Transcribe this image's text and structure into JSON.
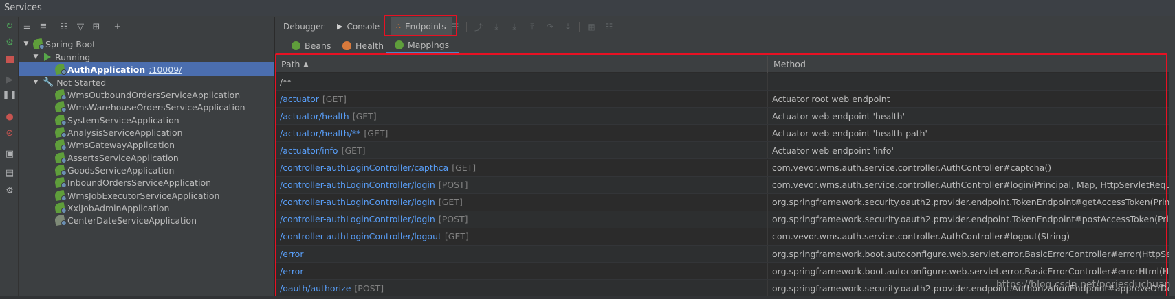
{
  "window": {
    "title": "Services"
  },
  "colors": {
    "highlight": "#e81123",
    "link": "#589df6",
    "selection": "#4b6eaf"
  },
  "left_toolbar": {
    "icons": [
      "refresh-icon",
      "deploy-icon",
      "stop-icon",
      "resume-icon",
      "pause-icon",
      "breakpoints-icon",
      "mute-breakpoints-icon",
      "camera-icon",
      "layout-icon",
      "settings-icon"
    ]
  },
  "tree_toolbar": {
    "icons": [
      "expand-all-icon",
      "collapse-all-icon",
      "group-icon",
      "filter-icon",
      "new-window-icon",
      "add-icon"
    ]
  },
  "tree": {
    "root": "Spring Boot",
    "running_label": "Running",
    "running": [
      {
        "name": "AuthApplication",
        "port": ":10009/"
      }
    ],
    "not_started_label": "Not Started",
    "not_started": [
      "WmsOutboundOrdersServiceApplication",
      "WmsWarehouseOrdersServiceApplication",
      "SystemServiceApplication",
      "AnalysisServiceApplication",
      "WmsGatewayApplication",
      "AssertsServiceApplication",
      "GoodsServiceApplication",
      "InboundOrdersServiceApplication",
      "WmsJobExecutorServiceApplication",
      "XxlJobAdminApplication",
      "CenterDateServiceApplication"
    ]
  },
  "tabs": [
    "Debugger",
    "Console",
    "Endpoints"
  ],
  "active_tab": "Endpoints",
  "subtabs": [
    "Beans",
    "Health",
    "Mappings"
  ],
  "active_subtab": "Mappings",
  "table": {
    "columns": [
      "Path",
      "Method"
    ],
    "rows": [
      {
        "path": "/**",
        "verb": "",
        "method": ""
      },
      {
        "path": "/actuator",
        "verb": "[GET]",
        "method": "Actuator root web endpoint"
      },
      {
        "path": "/actuator/health",
        "verb": "[GET]",
        "method": "Actuator web endpoint 'health'"
      },
      {
        "path": "/actuator/health/**",
        "verb": "[GET]",
        "method": "Actuator web endpoint 'health-path'"
      },
      {
        "path": "/actuator/info",
        "verb": "[GET]",
        "method": "Actuator web endpoint 'info'"
      },
      {
        "path": "/controller-authLoginController/capthca",
        "verb": "[GET]",
        "method": "com.vevor.wms.auth.service.controller.AuthController#captcha()"
      },
      {
        "path": "/controller-authLoginController/login",
        "verb": "[POST]",
        "method": "com.vevor.wms.auth.service.controller.AuthController#login(Principal, Map, HttpServletRequest, HttpS"
      },
      {
        "path": "/controller-authLoginController/login",
        "verb": "[GET]",
        "method": "org.springframework.security.oauth2.provider.endpoint.TokenEndpoint#getAccessToken(Principal, M"
      },
      {
        "path": "/controller-authLoginController/login",
        "verb": "[POST]",
        "method": "org.springframework.security.oauth2.provider.endpoint.TokenEndpoint#postAccessToken(Principal, M"
      },
      {
        "path": "/controller-authLoginController/logout",
        "verb": "[GET]",
        "method": "com.vevor.wms.auth.service.controller.AuthController#logout(String)"
      },
      {
        "path": "/error",
        "verb": "",
        "method": "org.springframework.boot.autoconfigure.web.servlet.error.BasicErrorController#error(HttpServletReq"
      },
      {
        "path": "/error",
        "verb": "",
        "method": "org.springframework.boot.autoconfigure.web.servlet.error.BasicErrorController#errorHtml(HttpServle"
      },
      {
        "path": "/oauth/authorize",
        "verb": "[POST]",
        "method": "org.springframework.security.oauth2.provider.endpoint.AuthorizationEndpoint#approveOrDeny(Map"
      }
    ]
  },
  "watermark": "https://blog.csdn.net/poriesduchuan"
}
